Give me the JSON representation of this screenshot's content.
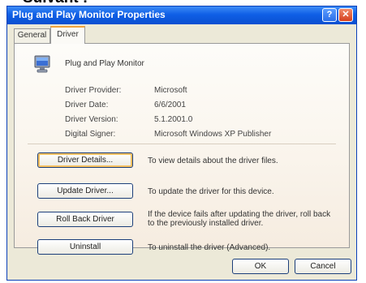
{
  "caption": "Suivant :",
  "window": {
    "title": "Plug and Play Monitor Properties",
    "help_glyph": "?",
    "close_glyph": "✕"
  },
  "tabs": [
    {
      "label": "General",
      "active": false
    },
    {
      "label": "Driver",
      "active": true
    }
  ],
  "device": {
    "name": "Plug and Play Monitor",
    "icon": "monitor-icon"
  },
  "properties": [
    {
      "label": "Driver Provider:",
      "value": "Microsoft"
    },
    {
      "label": "Driver Date:",
      "value": "6/6/2001"
    },
    {
      "label": "Driver Version:",
      "value": "5.1.2001.0"
    },
    {
      "label": "Digital Signer:",
      "value": "Microsoft Windows XP Publisher"
    }
  ],
  "actions": [
    {
      "button": "Driver Details...",
      "description": "To view details about the driver files."
    },
    {
      "button": "Update Driver...",
      "description": "To update the driver for this device."
    },
    {
      "button": "Roll Back Driver",
      "description": "If the device fails after updating the driver, roll back to the previously installed driver."
    },
    {
      "button": "Uninstall",
      "description": "To uninstall the driver (Advanced)."
    }
  ],
  "footer": {
    "ok_label": "OK",
    "cancel_label": "Cancel"
  },
  "colors": {
    "titlebar": "#0f5fe6",
    "dialog_bg": "#ece9d8",
    "active_tab_accent": "#f2a33a"
  }
}
